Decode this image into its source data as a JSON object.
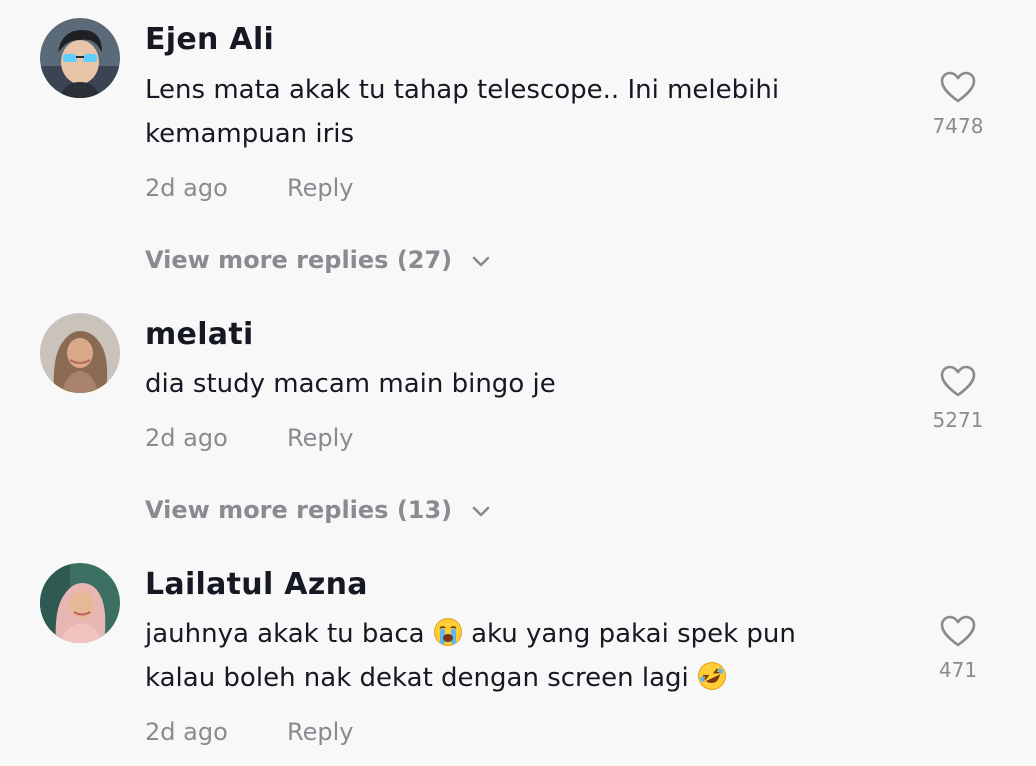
{
  "comments": [
    {
      "username": "Ejen Ali",
      "text": "Lens mata akak tu tahap telescope.. Ini melebihi kemampuan iris",
      "time": "2d ago",
      "reply_label": "Reply",
      "likes": "7478",
      "more_replies": "View more replies (27)"
    },
    {
      "username": "melati",
      "text": "dia study macam main bingo je",
      "time": "2d ago",
      "reply_label": "Reply",
      "likes": "5271",
      "more_replies": "View more replies (13)"
    },
    {
      "username": "Lailatul Azna",
      "text_part1": "jauhnya akak tu baca",
      "text_part2": "aku yang pakai spek pun kalau boleh nak dekat dengan screen lagi",
      "emoji1": "loudly-crying-face",
      "emoji2": "rolling-on-the-floor-laughing",
      "time": "2d ago",
      "reply_label": "Reply",
      "likes": "471"
    }
  ],
  "colors": {
    "background": "#f8f8f8",
    "username": "#161823",
    "secondary": "#8a8b91"
  }
}
